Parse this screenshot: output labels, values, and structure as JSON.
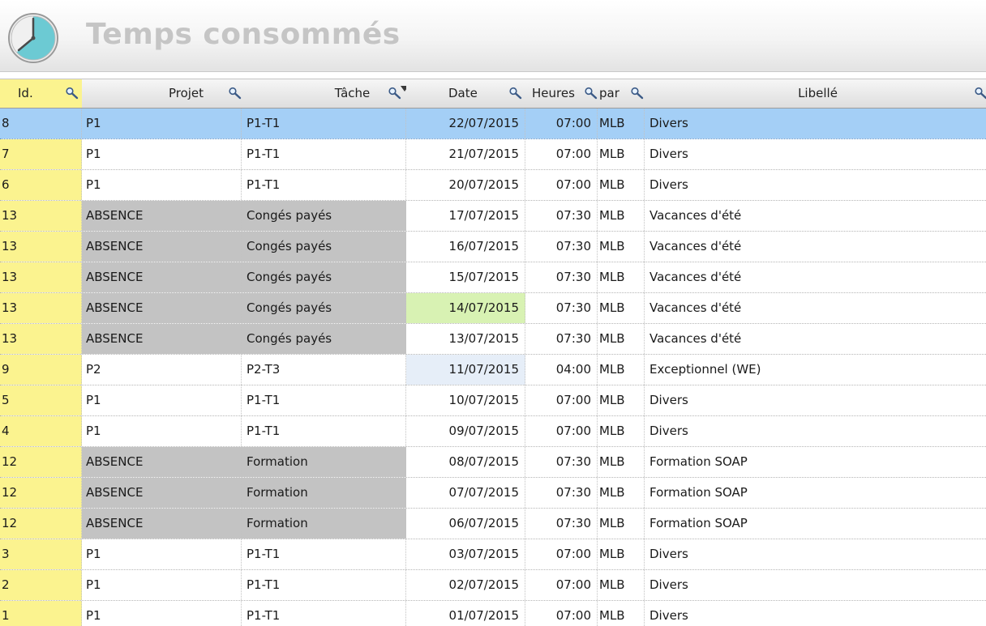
{
  "window": {
    "title": "Temps consommés"
  },
  "table": {
    "columns": [
      "Id.",
      "Projet",
      "Tâche",
      "Date",
      "Heures",
      "par",
      "Libellé"
    ],
    "rows": [
      {
        "id": "8",
        "projet": "P1",
        "tache": "P1-T1",
        "date": "22/07/2015",
        "heures": "07:00",
        "par": "MLB",
        "libelle": "Divers",
        "selected": true
      },
      {
        "id": "7",
        "projet": "P1",
        "tache": "P1-T1",
        "date": "21/07/2015",
        "heures": "07:00",
        "par": "MLB",
        "libelle": "Divers"
      },
      {
        "id": "6",
        "projet": "P1",
        "tache": "P1-T1",
        "date": "20/07/2015",
        "heures": "07:00",
        "par": "MLB",
        "libelle": "Divers"
      },
      {
        "id": "13",
        "projet": "ABSENCE",
        "tache": "Congés payés",
        "date": "17/07/2015",
        "heures": "07:30",
        "par": "MLB",
        "libelle": "Vacances d'été",
        "absence": true
      },
      {
        "id": "13",
        "projet": "ABSENCE",
        "tache": "Congés payés",
        "date": "16/07/2015",
        "heures": "07:30",
        "par": "MLB",
        "libelle": "Vacances d'été",
        "absence": true
      },
      {
        "id": "13",
        "projet": "ABSENCE",
        "tache": "Congés payés",
        "date": "15/07/2015",
        "heures": "07:30",
        "par": "MLB",
        "libelle": "Vacances d'été",
        "absence": true
      },
      {
        "id": "13",
        "projet": "ABSENCE",
        "tache": "Congés payés",
        "date": "14/07/2015",
        "heures": "07:30",
        "par": "MLB",
        "libelle": "Vacances d'été",
        "absence": true,
        "date_highlight": "holiday"
      },
      {
        "id": "13",
        "projet": "ABSENCE",
        "tache": "Congés payés",
        "date": "13/07/2015",
        "heures": "07:30",
        "par": "MLB",
        "libelle": "Vacances d'été",
        "absence": true
      },
      {
        "id": "9",
        "projet": "P2",
        "tache": "P2-T3",
        "date": "11/07/2015",
        "heures": "04:00",
        "par": "MLB",
        "libelle": "Exceptionnel (WE)",
        "date_highlight": "weekend"
      },
      {
        "id": "5",
        "projet": "P1",
        "tache": "P1-T1",
        "date": "10/07/2015",
        "heures": "07:00",
        "par": "MLB",
        "libelle": "Divers"
      },
      {
        "id": "4",
        "projet": "P1",
        "tache": "P1-T1",
        "date": "09/07/2015",
        "heures": "07:00",
        "par": "MLB",
        "libelle": "Divers"
      },
      {
        "id": "12",
        "projet": "ABSENCE",
        "tache": "Formation",
        "date": "08/07/2015",
        "heures": "07:30",
        "par": "MLB",
        "libelle": "Formation SOAP",
        "absence": true
      },
      {
        "id": "12",
        "projet": "ABSENCE",
        "tache": "Formation",
        "date": "07/07/2015",
        "heures": "07:30",
        "par": "MLB",
        "libelle": "Formation SOAP",
        "absence": true
      },
      {
        "id": "12",
        "projet": "ABSENCE",
        "tache": "Formation",
        "date": "06/07/2015",
        "heures": "07:30",
        "par": "MLB",
        "libelle": "Formation SOAP",
        "absence": true
      },
      {
        "id": "3",
        "projet": "P1",
        "tache": "P1-T1",
        "date": "03/07/2015",
        "heures": "07:00",
        "par": "MLB",
        "libelle": "Divers"
      },
      {
        "id": "2",
        "projet": "P1",
        "tache": "P1-T1",
        "date": "02/07/2015",
        "heures": "07:00",
        "par": "MLB",
        "libelle": "Divers"
      },
      {
        "id": "1",
        "projet": "P1",
        "tache": "P1-T1",
        "date": "01/07/2015",
        "heures": "07:00",
        "par": "MLB",
        "libelle": "Divers"
      }
    ]
  },
  "colors": {
    "id_column": "#fbf38f",
    "selected_row": "#a4cff6",
    "absence_cells": "#c3c3c3",
    "holiday_date": "#d8f2b3",
    "weekend_date": "#e6eef8"
  },
  "icons": {
    "title": "clock-icon",
    "column_search": "magnifier-icon",
    "sort": "sort-desc-icon"
  }
}
